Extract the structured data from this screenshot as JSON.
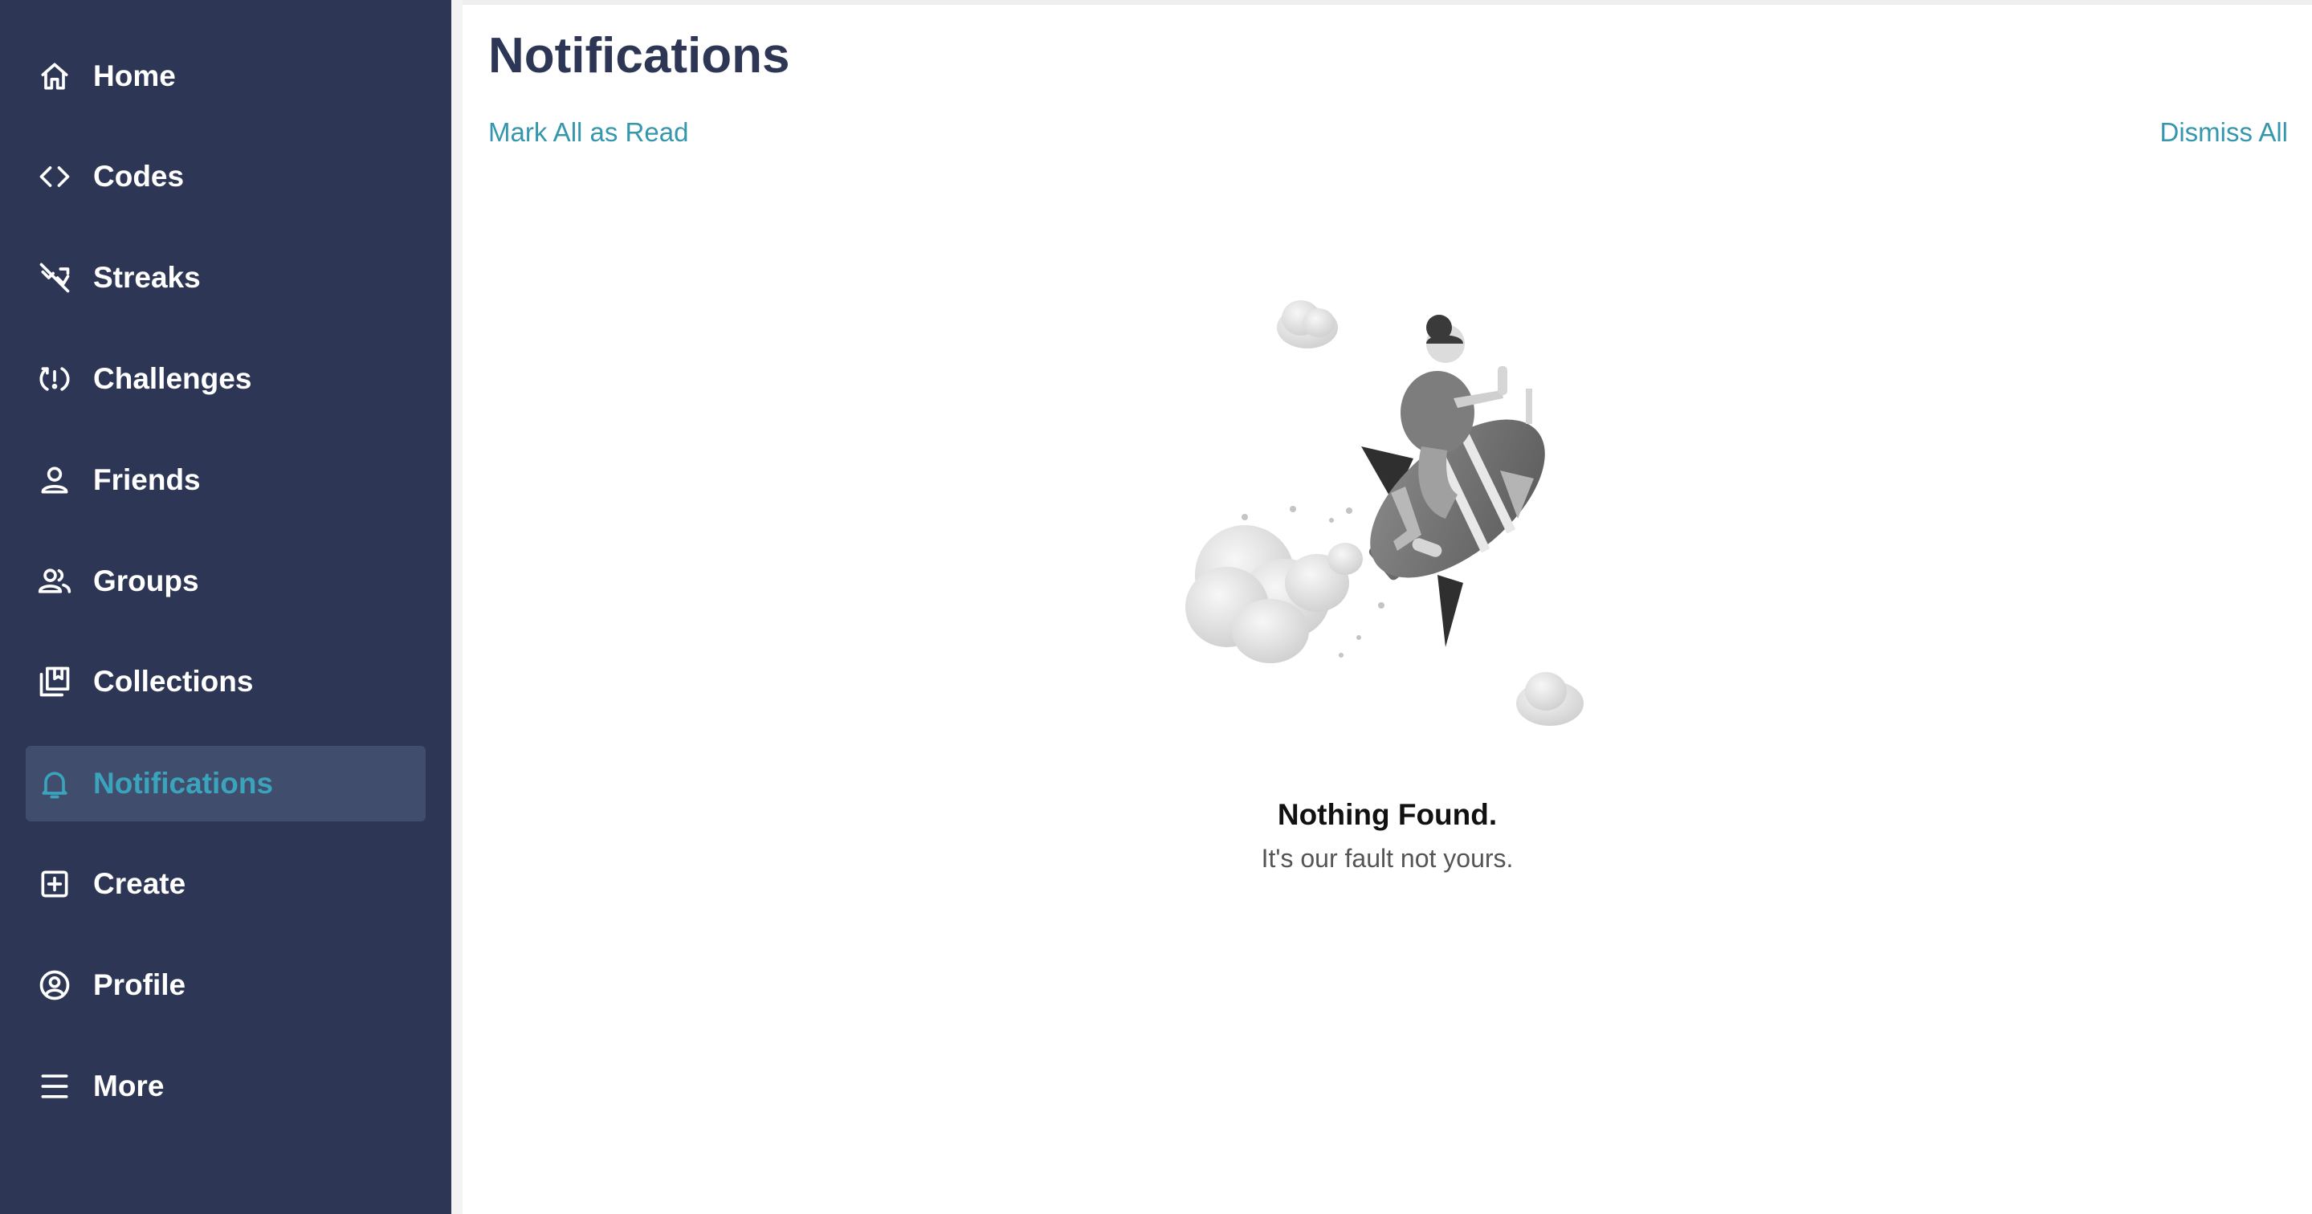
{
  "sidebar": {
    "items": [
      {
        "label": "Home",
        "icon": "home-icon"
      },
      {
        "label": "Codes",
        "icon": "code-brackets-icon"
      },
      {
        "label": "Streaks",
        "icon": "streak-off-icon"
      },
      {
        "label": "Challenges",
        "icon": "challenge-icon"
      },
      {
        "label": "Friends",
        "icon": "person-icon"
      },
      {
        "label": "Groups",
        "icon": "group-icon"
      },
      {
        "label": "Collections",
        "icon": "collection-icon"
      },
      {
        "label": "Notifications",
        "icon": "bell-icon",
        "active": true
      },
      {
        "label": "Create",
        "icon": "plus-square-icon"
      },
      {
        "label": "Profile",
        "icon": "profile-circle-icon"
      },
      {
        "label": "More",
        "icon": "menu-icon"
      }
    ]
  },
  "main": {
    "title": "Notifications",
    "mark_all_read_label": "Mark All as Read",
    "dismiss_all_label": "Dismiss All",
    "empty_state": {
      "illustration": "rocket-rider-illustration",
      "title": "Nothing Found.",
      "subtitle": "It's our fault not yours."
    }
  },
  "colors": {
    "sidebar_bg": "#2d3654",
    "sidebar_active_bg": "#414d6c",
    "accent": "#3ba4bd",
    "title": "#2d3654"
  }
}
